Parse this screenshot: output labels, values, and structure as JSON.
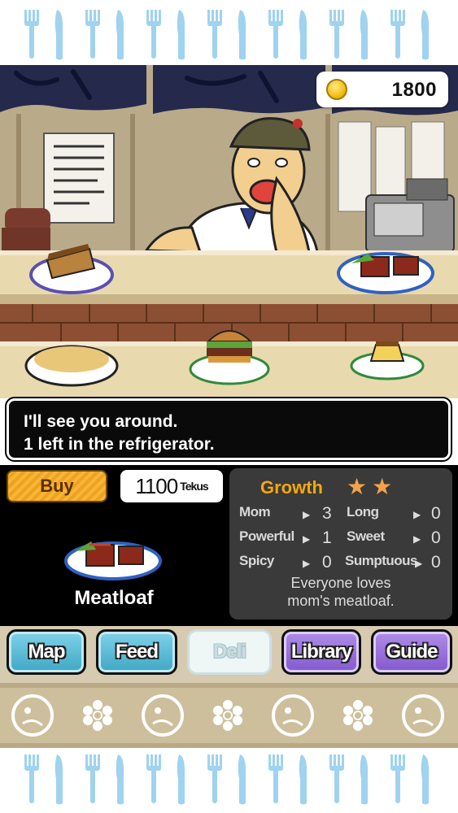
{
  "currency": {
    "amount": "1800",
    "icon": "coin-icon"
  },
  "dialog": {
    "line1": "I'll see you around.",
    "line2": "1 left in the refrigerator."
  },
  "item": {
    "buy_label": "Buy",
    "price_value": "1100",
    "price_unit": "Tekus",
    "name": "Meatloaf"
  },
  "growth": {
    "title": "Growth",
    "stars": 2,
    "stats": [
      {
        "label": "Mom",
        "value": "3"
      },
      {
        "label": "Long",
        "value": "0"
      },
      {
        "label": "Powerful",
        "value": "1"
      },
      {
        "label": "Sweet",
        "value": "0"
      },
      {
        "label": "Spicy",
        "value": "0"
      },
      {
        "label": "Sumptuous",
        "value": "0"
      }
    ],
    "description_line1": "Everyone loves",
    "description_line2": "mom's meatloaf."
  },
  "nav": {
    "map": "Map",
    "feed": "Feed",
    "deli": "Deli",
    "library": "Library",
    "guide": "Guide"
  },
  "colors": {
    "accent_orange": "#f2a80e",
    "button_blue": "#3fa7c4",
    "button_purple": "#8358cf",
    "cutlery_blue": "#9fd3ef"
  }
}
